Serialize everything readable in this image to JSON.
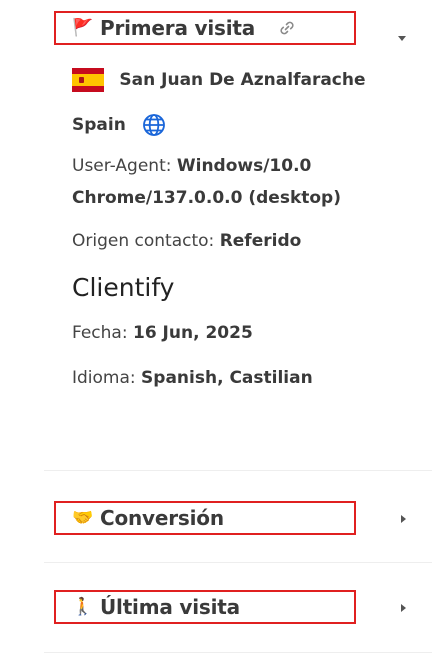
{
  "sections": {
    "primera": {
      "emoji": "🚩",
      "title": "Primera visita",
      "city": "San Juan De Aznalfarache",
      "country": "Spain",
      "ua_label": "User-Agent:",
      "ua_line1": "Windows/10.0",
      "ua_line2": "Chrome/137.0.0.0 (desktop)",
      "origin_label": "Origen contacto:",
      "origin_value": "Referido",
      "source": "Clientify",
      "date_label": "Fecha:",
      "date_value": "16 Jun, 2025",
      "lang_label": "Idioma:",
      "lang_value": "Spanish, Castilian"
    },
    "conversion": {
      "emoji": "🤝",
      "title": "Conversión"
    },
    "ultima": {
      "emoji": "🚶",
      "title": "Última visita"
    }
  },
  "icons": {
    "flag": "spain-flag-icon",
    "globe": "globe-icon",
    "link": "link-icon",
    "expanded": "caret-down-icon",
    "collapsed": "caret-right-icon"
  },
  "colors": {
    "highlight_border": "#e02020",
    "globe": "#1a66d9"
  }
}
